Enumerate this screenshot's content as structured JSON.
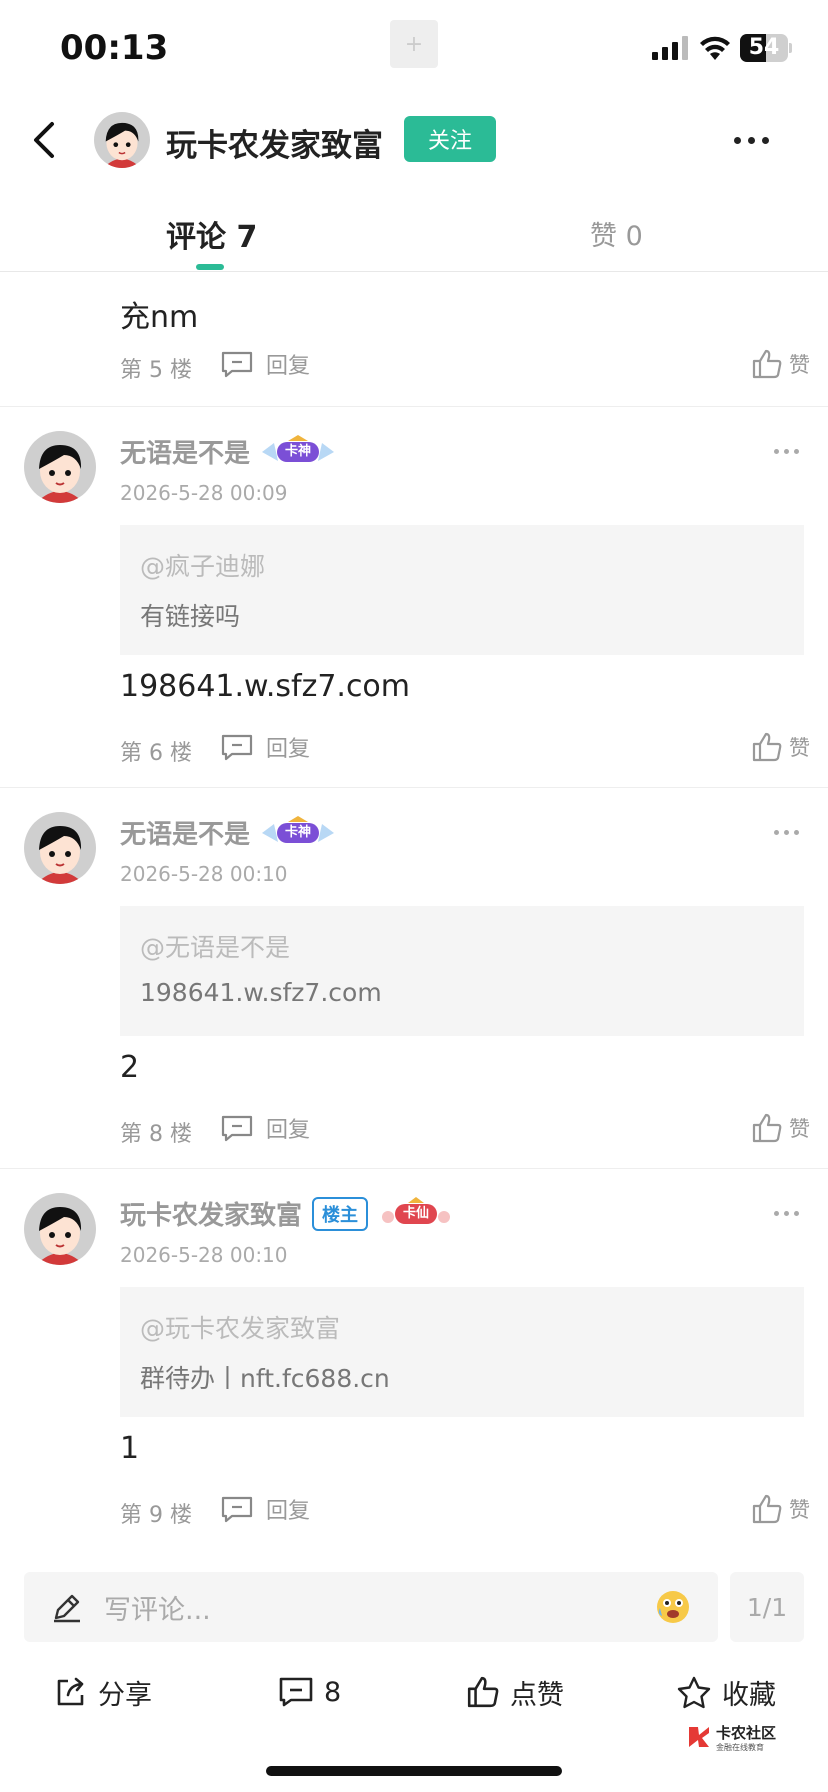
{
  "status_bar": {
    "time": "00:13",
    "battery_level": "54",
    "battery_fraction": 0.54,
    "center_icon": "plus-icon"
  },
  "header": {
    "title": "玩卡农发家致富",
    "follow_label": "关注",
    "back_icon": "back-chevron-icon",
    "more_icon": "more-horizontal-icon",
    "accent": "#2bbb96"
  },
  "tabs": {
    "comments_label": "评论 7",
    "likes_label": "赞 0"
  },
  "comments": [
    {
      "body": "充nm",
      "floor": "第 5 楼",
      "reply_label": "回复",
      "like_label": "赞"
    },
    {
      "name": "无语是不是",
      "badge": "卡神",
      "time": "2026-5-28 00:09",
      "quote_at": "@疯子迪娜",
      "quote_text": "有链接吗",
      "body": "198641.w.sfz7.com",
      "floor": "第 6 楼",
      "reply_label": "回复",
      "like_label": "赞"
    },
    {
      "name": "无语是不是",
      "badge": "卡神",
      "time": "2026-5-28 00:10",
      "quote_at": "@无语是不是",
      "quote_text": "198641.w.sfz7.com",
      "body": "2",
      "floor": "第 8 楼",
      "reply_label": "回复",
      "like_label": "赞"
    },
    {
      "name": "玩卡农发家致富",
      "owner_badge": "楼主",
      "badge": "卡仙",
      "time": "2026-5-28 00:10",
      "quote_at": "@玩卡农发家致富",
      "quote_text": "群待办丨nft.fc688.cn",
      "body": "1",
      "floor": "第 9 楼",
      "reply_label": "回复",
      "like_label": "赞"
    }
  ],
  "input": {
    "placeholder": "写评论...",
    "page": "1/1"
  },
  "actions": {
    "share": "分享",
    "comment_count": "8",
    "like": "点赞",
    "favorite": "收藏"
  },
  "watermark": {
    "title": "卡农社区",
    "subtitle": "金融在线教育"
  }
}
